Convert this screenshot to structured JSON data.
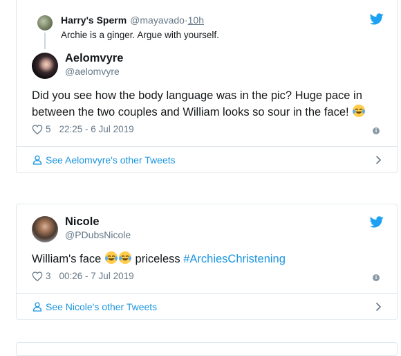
{
  "tweet1": {
    "quoted": {
      "name": "Harry's Sperm",
      "handle": "@mayavado",
      "sep": " · ",
      "time": "10h",
      "text": "Archie is a ginger. Argue with yourself."
    },
    "name": "Aelomvyre",
    "handle": "@aelomvyre",
    "text": "Did you see how the body language was in the pic? Huge pace in between the two couples and William looks so sour in the face!",
    "likes": "5",
    "timestamp": "22:25 - 6 Jul 2019",
    "footer_label": "See Aelomvyre's other Tweets"
  },
  "tweet2": {
    "name": "Nicole",
    "handle": "@PDubsNicole",
    "text_before": "William's face",
    "text_after": "priceless",
    "hashtag": "#ArchiesChristening",
    "likes": "3",
    "timestamp": "00:26 - 7 Jul 2019",
    "footer_label": "See Nicole's other Tweets"
  },
  "colors": {
    "accent": "#1b95e0",
    "muted": "#657786",
    "border": "#e1e8ed",
    "twitter_blue": "#1da1f2"
  },
  "icons": {
    "bird": "twitter-bird-icon",
    "heart": "heart-icon",
    "info": "info-icon",
    "person": "person-icon",
    "chevron": "chevron-right-icon",
    "emoji": "tears-of-joy-emoji"
  }
}
